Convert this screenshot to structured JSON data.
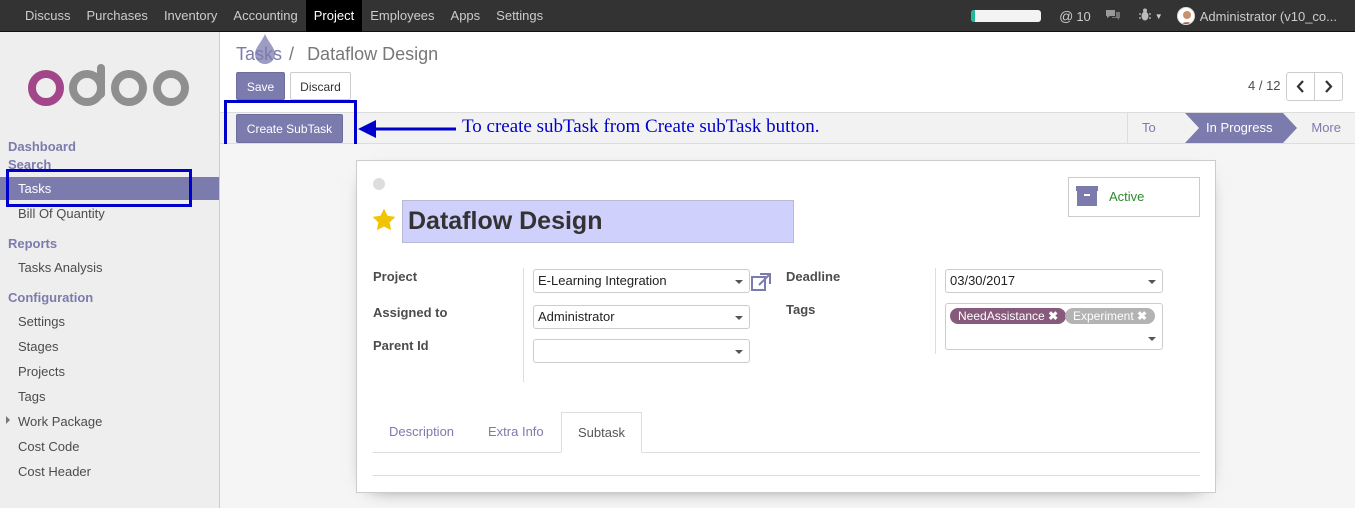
{
  "topbar": {
    "menu": [
      "Discuss",
      "Purchases",
      "Inventory",
      "Accounting",
      "Project",
      "Employees",
      "Apps",
      "Settings"
    ],
    "active": "Project",
    "messages_count": "10",
    "user": "Administrator (v10_co...",
    "progress": 0.05,
    "progress_color": "#21b799"
  },
  "sidebar": {
    "logo": "odoo",
    "sections": [
      {
        "title": "Dashboard"
      },
      {
        "title": "Search"
      },
      {
        "title": "Reports"
      },
      {
        "title": "Configuration"
      }
    ],
    "items": {
      "tasks": "Tasks",
      "boq": "Bill Of Quantity",
      "tasks_analysis": "Tasks Analysis",
      "settings": "Settings",
      "stages": "Stages",
      "projects": "Projects",
      "tags": "Tags",
      "work_package": "Work Package",
      "cost_code": "Cost Code",
      "cost_header": "Cost Header"
    }
  },
  "breadcrumb": {
    "parent": "Tasks",
    "sep": "/",
    "current": "Dataflow Design"
  },
  "buttons": {
    "save": "Save",
    "discard": "Discard",
    "create_subtask": "Create SubTask"
  },
  "pager": {
    "value": "4 / 12"
  },
  "annotation": "To create subTask from Create subTask button.",
  "stages": {
    "todo": "To Do",
    "in_progress": "In Progress",
    "more": "More"
  },
  "active_toggle": "Active",
  "form": {
    "title": "Dataflow Design",
    "project_label": "Project",
    "project_value": "E-Learning Integration",
    "assigned_label": "Assigned to",
    "assigned_value": "Administrator",
    "parent_label": "Parent Id",
    "parent_value": "",
    "deadline_label": "Deadline",
    "deadline_value": "03/30/2017",
    "tags_label": "Tags",
    "tags": [
      {
        "name": "NeedAssistance",
        "color": "#875a7b"
      },
      {
        "name": "Experiment",
        "color": "#b3b3b3"
      }
    ]
  },
  "tabs": [
    "Description",
    "Extra Info",
    "Subtask"
  ],
  "active_tab": "Subtask",
  "colors": {
    "brand": "#7c7bad",
    "annotation": "#0000cc",
    "star": "#f0c400"
  }
}
